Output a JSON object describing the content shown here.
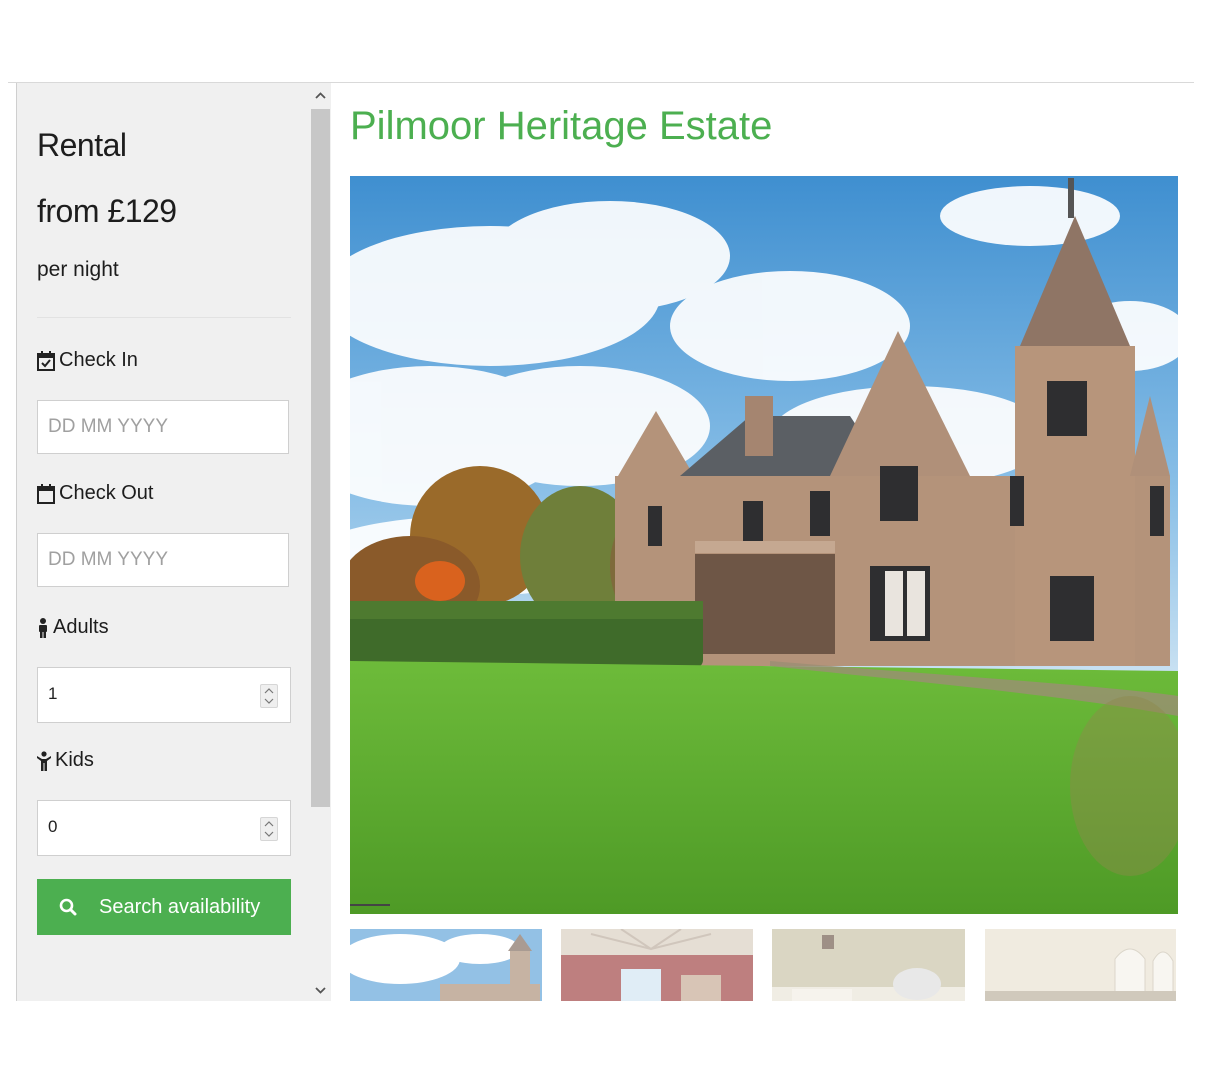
{
  "sidebar": {
    "rental_label": "Rental",
    "price_line": "from £129",
    "price_unit": "per night",
    "check_in": {
      "label": "Check In",
      "placeholder": "DD MM YYYY",
      "icon": "calendar-check-icon"
    },
    "check_out": {
      "label": "Check Out",
      "placeholder": "DD MM YYYY",
      "icon": "calendar-icon"
    },
    "adults": {
      "label": "Adults",
      "value": "1",
      "icon": "male-icon"
    },
    "kids": {
      "label": "Kids",
      "value": "0",
      "icon": "child-icon"
    },
    "search_button": {
      "label": "Search availability",
      "icon": "search-icon"
    }
  },
  "main": {
    "title": "Pilmoor Heritage Estate"
  },
  "colors": {
    "accent": "#4caf50",
    "sidebar_bg": "#f0f0f0"
  }
}
